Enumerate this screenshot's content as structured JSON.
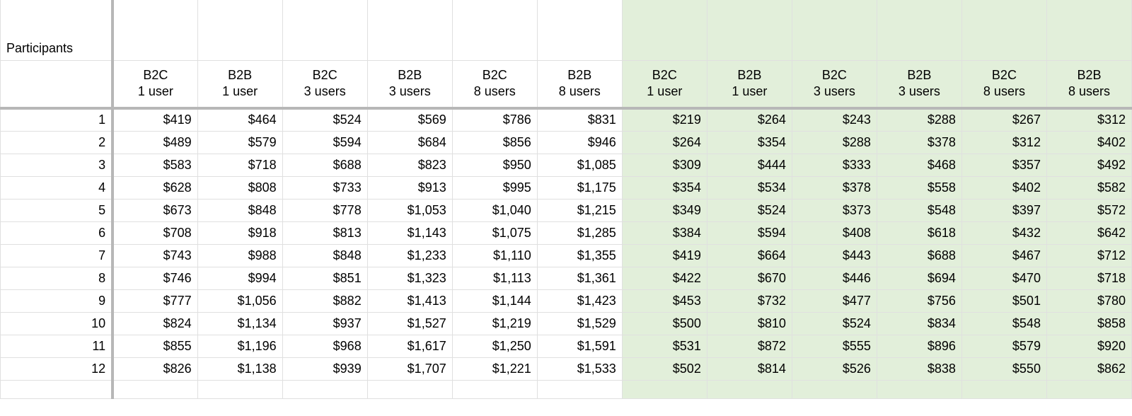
{
  "labels": {
    "participants": "Participants"
  },
  "columns": [
    {
      "line1": "B2C",
      "line2": "1 user"
    },
    {
      "line1": "B2B",
      "line2": "1 user"
    },
    {
      "line1": "B2C",
      "line2": "3 users"
    },
    {
      "line1": "B2B",
      "line2": "3 users"
    },
    {
      "line1": "B2C",
      "line2": "8 users"
    },
    {
      "line1": "B2B",
      "line2": "8 users"
    },
    {
      "line1": "B2C",
      "line2": "1 user"
    },
    {
      "line1": "B2B",
      "line2": "1 user"
    },
    {
      "line1": "B2C",
      "line2": "3 users"
    },
    {
      "line1": "B2B",
      "line2": "3 users"
    },
    {
      "line1": "B2C",
      "line2": "8 users"
    },
    {
      "line1": "B2B",
      "line2": "8 users"
    }
  ],
  "green_start_index": 6,
  "rows": [
    {
      "n": "1",
      "v": [
        "$419",
        "$464",
        "$524",
        "$569",
        "$786",
        "$831",
        "$219",
        "$264",
        "$243",
        "$288",
        "$267",
        "$312"
      ]
    },
    {
      "n": "2",
      "v": [
        "$489",
        "$579",
        "$594",
        "$684",
        "$856",
        "$946",
        "$264",
        "$354",
        "$288",
        "$378",
        "$312",
        "$402"
      ]
    },
    {
      "n": "3",
      "v": [
        "$583",
        "$718",
        "$688",
        "$823",
        "$950",
        "$1,085",
        "$309",
        "$444",
        "$333",
        "$468",
        "$357",
        "$492"
      ]
    },
    {
      "n": "4",
      "v": [
        "$628",
        "$808",
        "$733",
        "$913",
        "$995",
        "$1,175",
        "$354",
        "$534",
        "$378",
        "$558",
        "$402",
        "$582"
      ]
    },
    {
      "n": "5",
      "v": [
        "$673",
        "$848",
        "$778",
        "$1,053",
        "$1,040",
        "$1,215",
        "$349",
        "$524",
        "$373",
        "$548",
        "$397",
        "$572"
      ]
    },
    {
      "n": "6",
      "v": [
        "$708",
        "$918",
        "$813",
        "$1,143",
        "$1,075",
        "$1,285",
        "$384",
        "$594",
        "$408",
        "$618",
        "$432",
        "$642"
      ]
    },
    {
      "n": "7",
      "v": [
        "$743",
        "$988",
        "$848",
        "$1,233",
        "$1,110",
        "$1,355",
        "$419",
        "$664",
        "$443",
        "$688",
        "$467",
        "$712"
      ]
    },
    {
      "n": "8",
      "v": [
        "$746",
        "$994",
        "$851",
        "$1,323",
        "$1,113",
        "$1,361",
        "$422",
        "$670",
        "$446",
        "$694",
        "$470",
        "$718"
      ]
    },
    {
      "n": "9",
      "v": [
        "$777",
        "$1,056",
        "$882",
        "$1,413",
        "$1,144",
        "$1,423",
        "$453",
        "$732",
        "$477",
        "$756",
        "$501",
        "$780"
      ]
    },
    {
      "n": "10",
      "v": [
        "$824",
        "$1,134",
        "$937",
        "$1,527",
        "$1,219",
        "$1,529",
        "$500",
        "$810",
        "$524",
        "$834",
        "$548",
        "$858"
      ]
    },
    {
      "n": "11",
      "v": [
        "$855",
        "$1,196",
        "$968",
        "$1,617",
        "$1,250",
        "$1,591",
        "$531",
        "$872",
        "$555",
        "$896",
        "$579",
        "$920"
      ]
    },
    {
      "n": "12",
      "v": [
        "$826",
        "$1,138",
        "$939",
        "$1,707",
        "$1,221",
        "$1,533",
        "$502",
        "$814",
        "$526",
        "$838",
        "$550",
        "$862"
      ]
    }
  ]
}
